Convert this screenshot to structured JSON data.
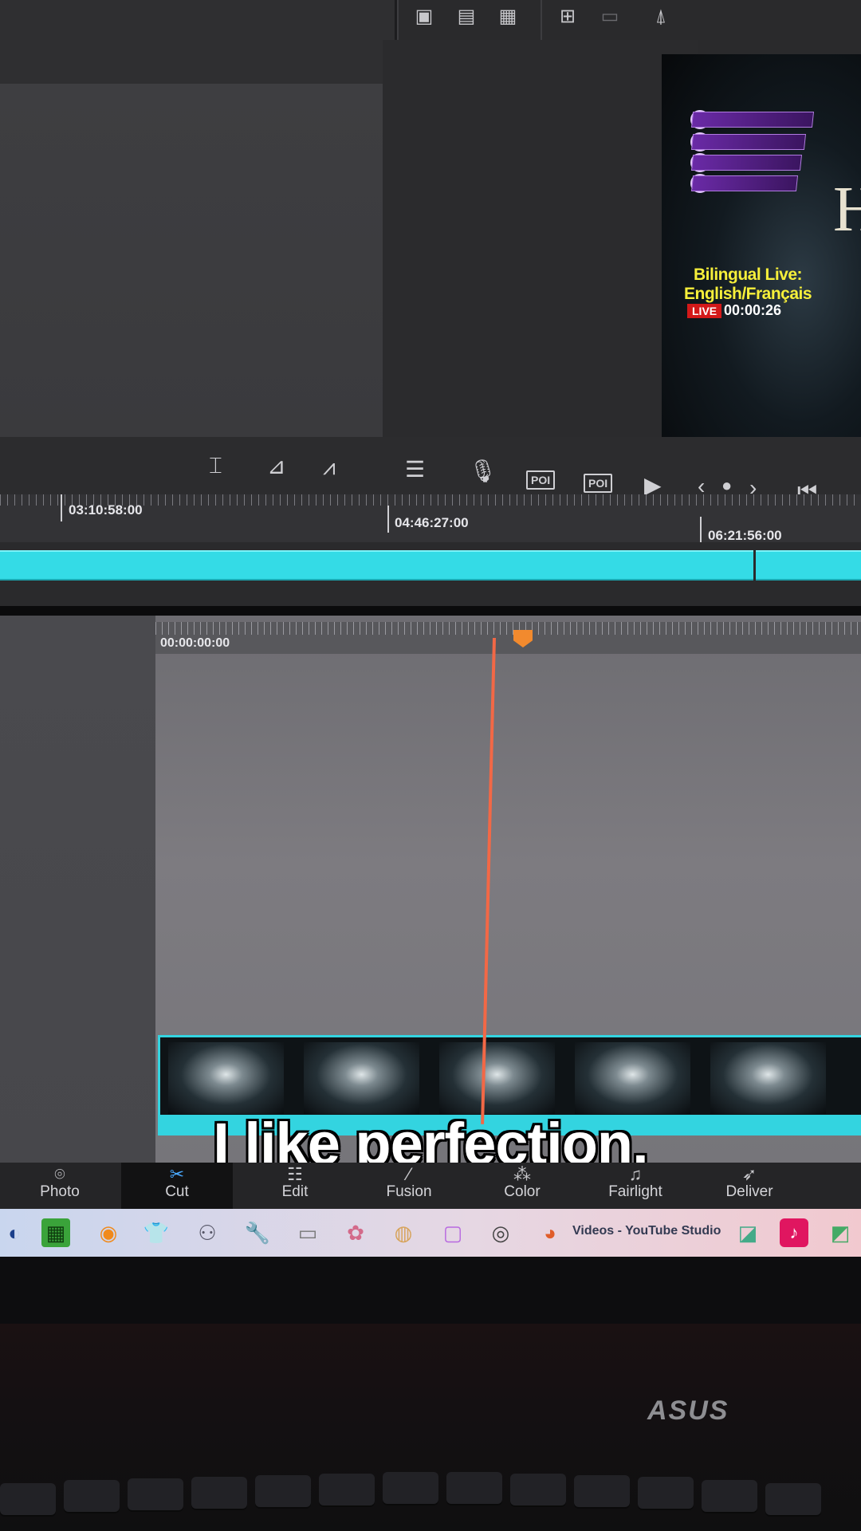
{
  "viewer_overlay": {
    "title_line1": "Bilingual Live:",
    "title_line2": "English/Français",
    "live_badge": "LIVE",
    "live_timer": "00:00:26"
  },
  "timeline": {
    "upper_ruler": [
      "03:10:58:00",
      "04:46:27:00",
      "06:21:56:00"
    ],
    "lower_ruler_start": "00:00:00:00"
  },
  "controls": {
    "poi_label": "POI"
  },
  "caption": "I like perfection.",
  "pages": [
    {
      "label": "Photo",
      "icon": "camera-icon"
    },
    {
      "label": "Cut",
      "icon": "cut-icon"
    },
    {
      "label": "Edit",
      "icon": "edit-icon"
    },
    {
      "label": "Fusion",
      "icon": "fusion-icon"
    },
    {
      "label": "Color",
      "icon": "color-icon"
    },
    {
      "label": "Fairlight",
      "icon": "music-note-icon"
    },
    {
      "label": "Deliver",
      "icon": "rocket-icon"
    }
  ],
  "active_page": "Cut",
  "taskbar": {
    "youtube_label": "Videos - YouTube Studio"
  },
  "hardware": {
    "brand": "ASUS"
  },
  "colors": {
    "accent_cyan": "#34dbe6",
    "playhead": "#f26846",
    "live_red": "#d31919"
  }
}
